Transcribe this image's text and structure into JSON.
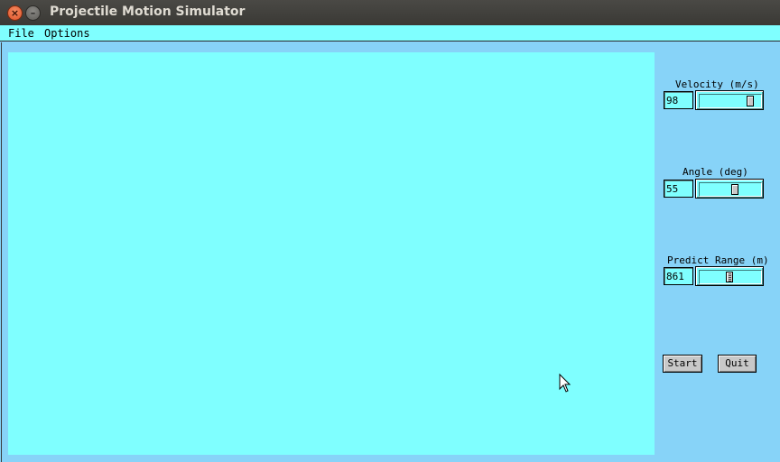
{
  "window": {
    "title": "Projectile Motion Simulator",
    "close_glyph": "×",
    "min_glyph": "–"
  },
  "menu": {
    "items": [
      "File",
      "Options"
    ]
  },
  "controls": {
    "velocity": {
      "label": "Velocity (m/s)",
      "value": "98",
      "slider_fraction": 0.9
    },
    "angle": {
      "label": "Angle (deg)",
      "value": "55",
      "slider_fraction": 0.6
    },
    "range": {
      "label": "Predict Range (m)",
      "value": "861",
      "slider_fraction": 0.5
    }
  },
  "buttons": {
    "start": "Start",
    "quit": "Quit"
  },
  "colors": {
    "canvas": "#7fffff",
    "background": "#87d3f8",
    "titlebar": "#3c3b37"
  }
}
